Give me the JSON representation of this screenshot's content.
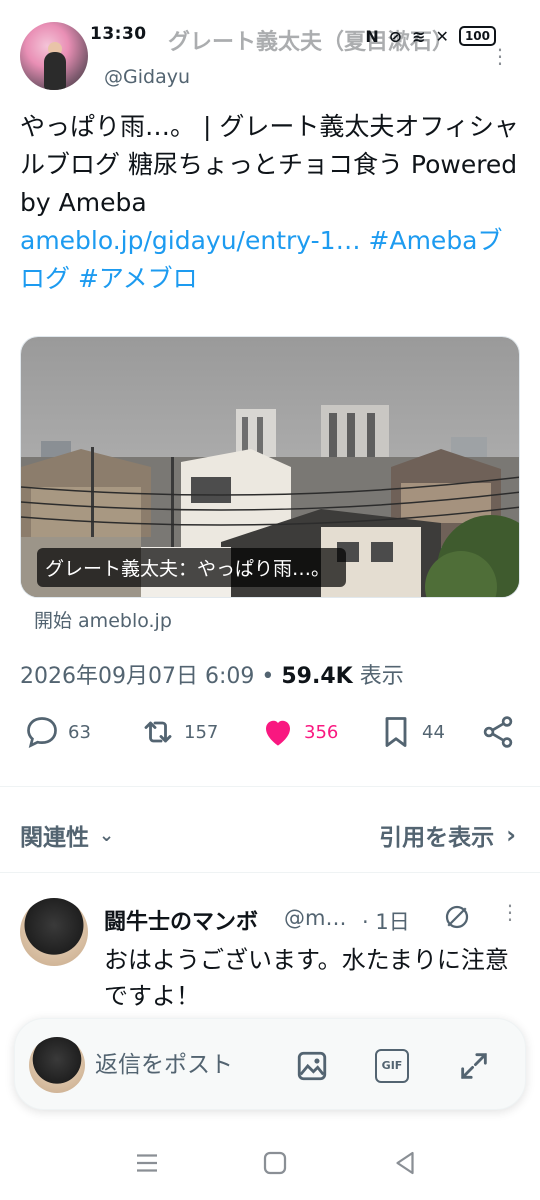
{
  "status_bar": {
    "time": "13:30",
    "notification_icons": "◎ ◔ 義 ⌐",
    "battery": "100",
    "overlay_name": "グレート義太夫（夏目漱石）"
  },
  "author": {
    "handle": "@Gidayu"
  },
  "tweet": {
    "text_line": "やっぱり雨…。 | グレート義太夫オフィシャルブログ 糖尿ちょっとチョコ食う Powered by Ameba",
    "link": "ameblo.jp/gidayu/entry-1…",
    "hashtag1": "#Ameba",
    "hashtag2": "ブログ",
    "hashtag3": "#アメブロ"
  },
  "card": {
    "caption": "グレート義太夫：やっぱり雨…。",
    "source": "開始 ameblo.jp"
  },
  "meta": {
    "timestamp": "2026年09月07日 6:09",
    "separator": "•",
    "views_count": "59.4K",
    "views_label": "表示"
  },
  "actions": {
    "replies": "63",
    "retweets": "157",
    "likes": "356",
    "bookmarks": "44"
  },
  "filters": {
    "relevance": "関連性",
    "quotes": "引用を表示"
  },
  "reply": {
    "name": "闘牛士のマンボ",
    "handle": "@m…",
    "time": "· 1日",
    "text": "おはようございます。水たまりに注意ですよ！"
  },
  "composer": {
    "placeholder": "返信をポスト",
    "gif_label": "GIF"
  },
  "colors": {
    "accent": "#1d9bf0",
    "like": "#f91880",
    "muted": "#536471"
  }
}
